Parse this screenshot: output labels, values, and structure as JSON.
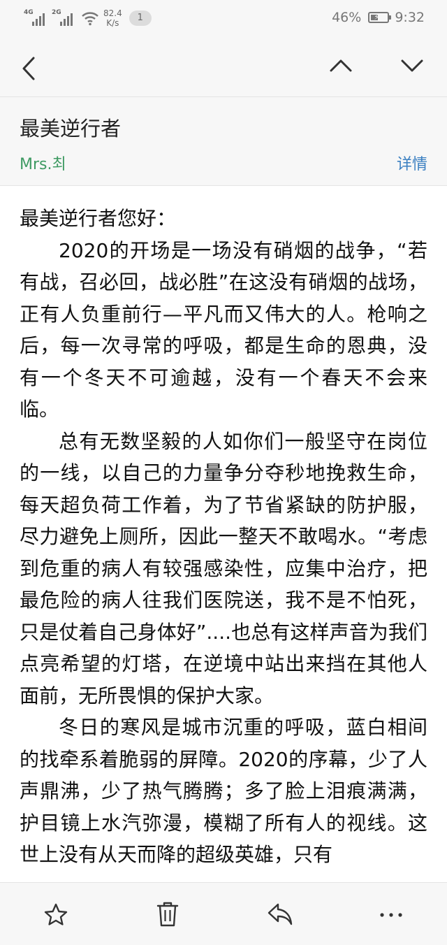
{
  "status_bar": {
    "sim1_type": "4G",
    "sim2_type": "2G",
    "speed_value": "82.4",
    "speed_unit": "K/s",
    "notification_count": "1",
    "battery_percent": "46%",
    "battery_level": 0.46,
    "time": "9:32"
  },
  "nav": {
    "back_icon": "chevron-left-icon",
    "prev_icon": "chevron-up-icon",
    "next_icon": "chevron-down-icon"
  },
  "mail": {
    "subject": "最美逆行者",
    "sender": "Mrs.최",
    "details_label": "详情",
    "sender_color": "#3e9a62",
    "details_color": "#3a7fc1"
  },
  "body": {
    "greeting": "最美逆行者您好：",
    "paragraphs": [
      "2020的开场是一场没有硝烟的战争，“若有战，召必回，战必胜”在这没有硝烟的战场，正有人负重前行—平凡而又伟大的人。枪响之后，每一次寻常的呼吸，都是生命的恩典，没有一个冬天不可逾越，没有一个春天不会来临。",
      "总有无数坚毅的人如你们一般坚守在岗位的一线，以自己的力量争分夺秒地挽救生命，每天超负荷工作着，为了节省紧缺的防护服，尽力避免上厕所，因此一整天不敢喝水。“考虑到危重的病人有较强感染性，应集中治疗，把最危险的病人往我们医院送，我不是不怕死，只是仗着自己身体好”....也总有这样声音为我们点亮希望的灯塔，在逆境中站出来挡在其他人面前，无所畏惧的保护大家。",
      "冬日的寒风是城市沉重的呼吸，蓝白相间的找牵系着脆弱的屏障。2020的序幕，少了人声鼎沸，少了热气腾腾；多了脸上泪痕满满，护目镜上水汽弥漫，模糊了所有人的视线。这世上没有从天而降的超级英雄，只有"
    ]
  },
  "toolbar": {
    "star_icon": "star-icon",
    "delete_icon": "trash-icon",
    "reply_icon": "reply-icon",
    "more_icon": "more-icon"
  }
}
